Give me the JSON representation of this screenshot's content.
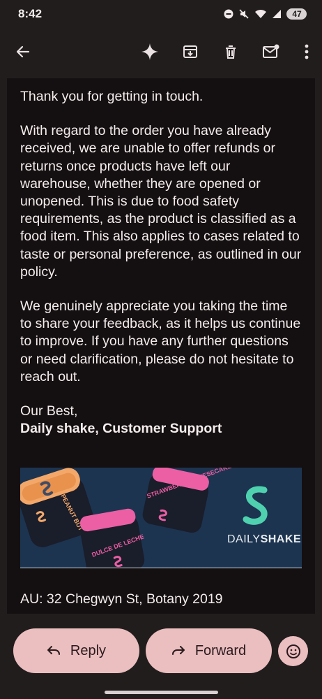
{
  "status_bar": {
    "time": "8:42",
    "battery": "47"
  },
  "message": {
    "paragraphs": [
      "Thank you for getting in touch.",
      "With regard to the order you have already received, we are unable to offer refunds or returns once products have left our warehouse, whether they are opened or unopened. This is due to food safety requirements, as the product is classified as a food item. This also applies to cases related to taste or personal preference, as outlined in our policy.",
      "We genuinely appreciate you taking the time to share your feedback, as it helps us continue to improve. If you have any further questions or need clarification, please do not hesitate to reach out."
    ],
    "closing": "Our Best,",
    "signature": "Daily shake, Customer Support",
    "banner": {
      "product_1": "PEANUT BUTTER",
      "product_2": "STRAWBERRY CHEESECAKE",
      "product_3": "DULCE DE LECHE",
      "brand_light": "DAILY",
      "brand_bold": "SHAKE"
    },
    "address": "AU: 32 Chegwyn St, Botany 2019"
  },
  "actions": {
    "reply": "Reply",
    "forward": "Forward"
  },
  "colors": {
    "background": "#211d1d",
    "message_bg": "#140f10",
    "pill": "#ebbec0",
    "banner": "#1c3450",
    "brand_accent": "#4fd1b0"
  },
  "icons": [
    "back-arrow-icon",
    "sparkle-icon",
    "archive-icon",
    "trash-icon",
    "mark-unread-icon",
    "more-vert-icon",
    "reply-icon",
    "forward-icon",
    "emoji-icon"
  ]
}
